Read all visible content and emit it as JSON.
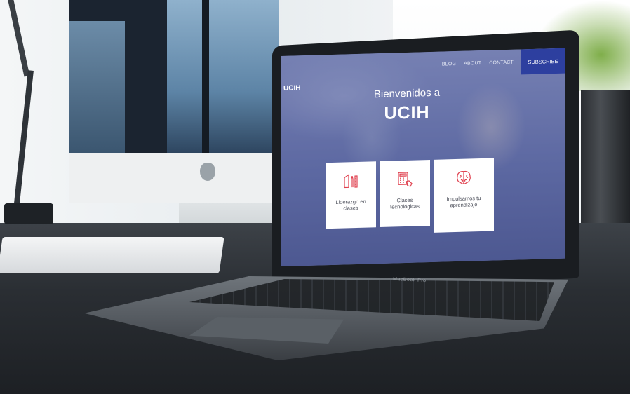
{
  "site": {
    "brand": "UCIH",
    "nav": [
      "BLOG",
      "ABOUT",
      "CONTACT"
    ],
    "subscribe_label": "SUBSCRIBE"
  },
  "hero": {
    "subtitle": "Bienvenidos a",
    "title": "UCIH"
  },
  "cards": [
    {
      "label": "Liderazgo en clases",
      "icon": "pencil-ruler-icon"
    },
    {
      "label": "Clases tecnológicas",
      "icon": "calculator-hand-icon"
    },
    {
      "label": "Impulsamos tu aprendizaje",
      "icon": "brain-icon"
    }
  ],
  "device": {
    "label": "MacBook Pro"
  },
  "colors": {
    "accent": "#e0414f",
    "subscribe_bg": "#2d3f9f",
    "overlay": "#4c5aa0"
  }
}
